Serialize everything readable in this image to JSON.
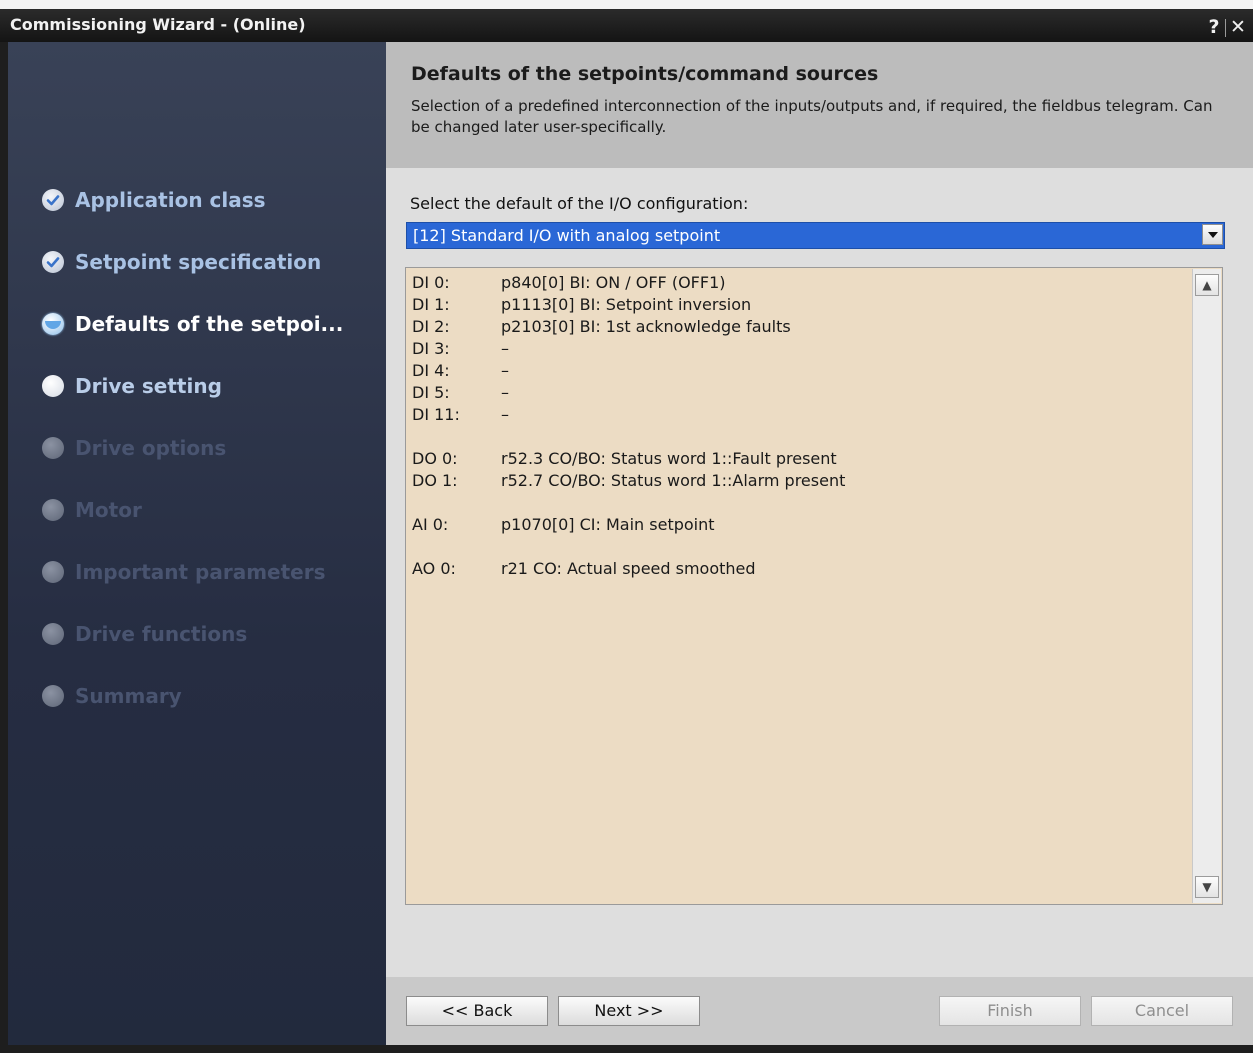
{
  "window": {
    "title": "Commissioning Wizard - (Online)",
    "help_label": "?",
    "close_label": "✕"
  },
  "sidebar": {
    "items": [
      {
        "label": "Application class",
        "state": "done"
      },
      {
        "label": "Setpoint specification",
        "state": "done"
      },
      {
        "label": "Defaults of the setpoi...",
        "state": "current"
      },
      {
        "label": "Drive setting",
        "state": "pending"
      },
      {
        "label": "Drive options",
        "state": "disabled"
      },
      {
        "label": "Motor",
        "state": "disabled"
      },
      {
        "label": "Important parameters",
        "state": "disabled"
      },
      {
        "label": "Drive functions",
        "state": "disabled"
      },
      {
        "label": "Summary",
        "state": "disabled"
      }
    ]
  },
  "header": {
    "title": "Defaults of the setpoints/command sources",
    "description": "Selection of a predefined interconnection of the inputs/outputs and, if required, the fieldbus telegram. Can be changed later user-specifically."
  },
  "io_config": {
    "label": "Select the default of the I/O configuration:",
    "selected": "[12] Standard I/O with analog setpoint",
    "lines": [
      {
        "signal": "DI 0:",
        "value": "p840[0] BI: ON / OFF (OFF1)"
      },
      {
        "signal": "DI 1:",
        "value": "p1113[0] BI: Setpoint inversion"
      },
      {
        "signal": "DI 2:",
        "value": "p2103[0] BI: 1st acknowledge faults"
      },
      {
        "signal": "DI 3:",
        "value": "–"
      },
      {
        "signal": "DI 4:",
        "value": "–"
      },
      {
        "signal": "DI 5:",
        "value": "–"
      },
      {
        "signal": "DI 11:",
        "value": "–"
      },
      {
        "signal": "DO 0:",
        "value": "r52.3 CO/BO: Status word 1::Fault present"
      },
      {
        "signal": "DO 1:",
        "value": "r52.7 CO/BO: Status word 1::Alarm present"
      },
      {
        "signal": "AI 0:",
        "value": "p1070[0] CI: Main setpoint"
      },
      {
        "signal": "AO 0:",
        "value": "r21 CO: Actual speed smoothed"
      }
    ]
  },
  "footer": {
    "back_label": "<< Back",
    "next_label": "Next >>",
    "finish_label": "Finish",
    "cancel_label": "Cancel"
  }
}
